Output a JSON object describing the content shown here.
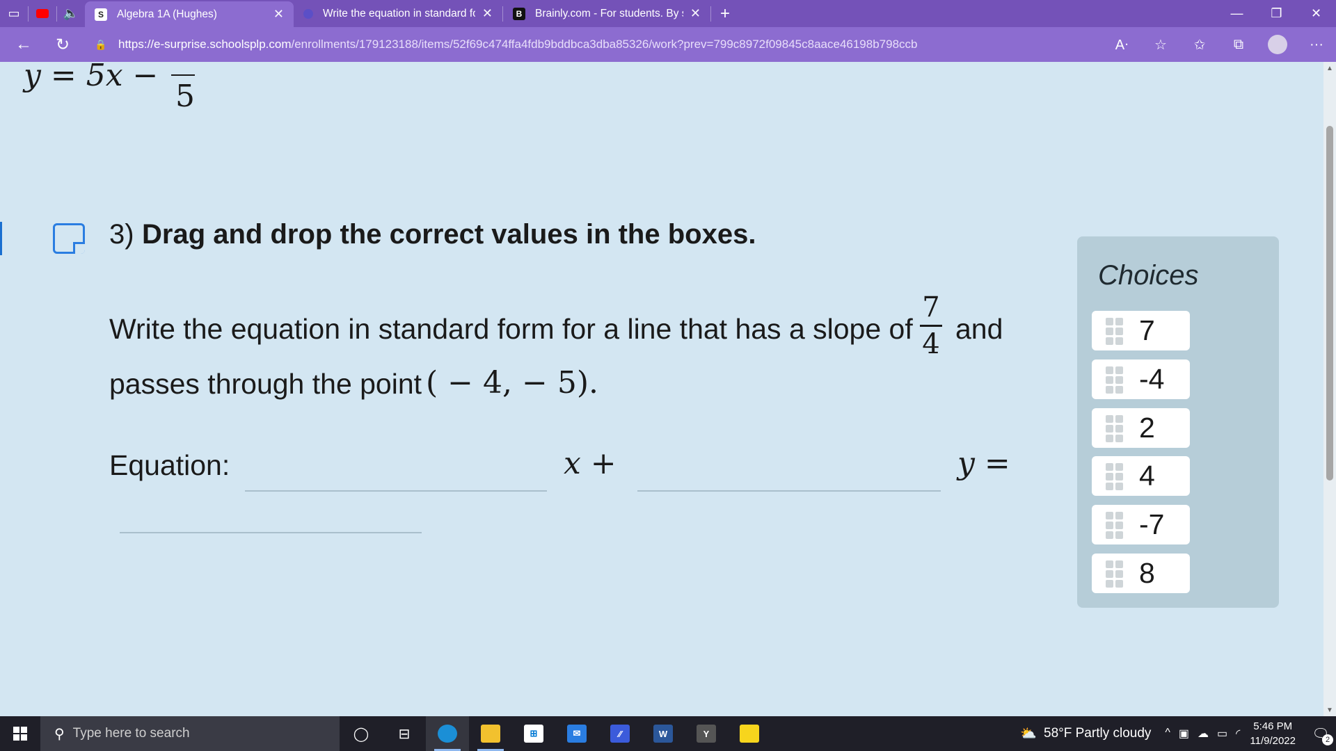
{
  "browser": {
    "tabs": [
      {
        "title": "Algebra 1A (Hughes)",
        "favicon": "S"
      },
      {
        "title": "Write the equation in standard fo",
        "favicon": ""
      },
      {
        "title": "Brainly.com - For students. By stu",
        "favicon": "B"
      }
    ],
    "url_host": "https://e-surprise.schoolsplp.com",
    "url_path": "/enrollments/179123188/items/52f69c474ffa4fdb9bddbca3dba85326/work?prev=799c8972f09845c8aace46198b798ccb"
  },
  "previous": {
    "eq_left": "y = 5x −",
    "eq_den": "5"
  },
  "question": {
    "number": "3)",
    "title": "Drag and drop the correct values in the boxes.",
    "prompt_line1": "Write the equation in standard form for a line that has a slope of",
    "slope_num": "7",
    "slope_den": "4",
    "prompt_line1_end": "and",
    "prompt_line2": "passes through the point",
    "point": "( − 4,  − 5).",
    "equation_label": "Equation:",
    "x_term": "x +",
    "y_term": "y ="
  },
  "choices": {
    "title": "Choices",
    "items": [
      "7",
      "-4",
      "2",
      "4",
      "-7",
      "8"
    ]
  },
  "taskbar": {
    "search_placeholder": "Type here to search",
    "weather": "58°F  Partly cloudy",
    "time": "5:46 PM",
    "date": "11/9/2022",
    "notifications": "2"
  }
}
